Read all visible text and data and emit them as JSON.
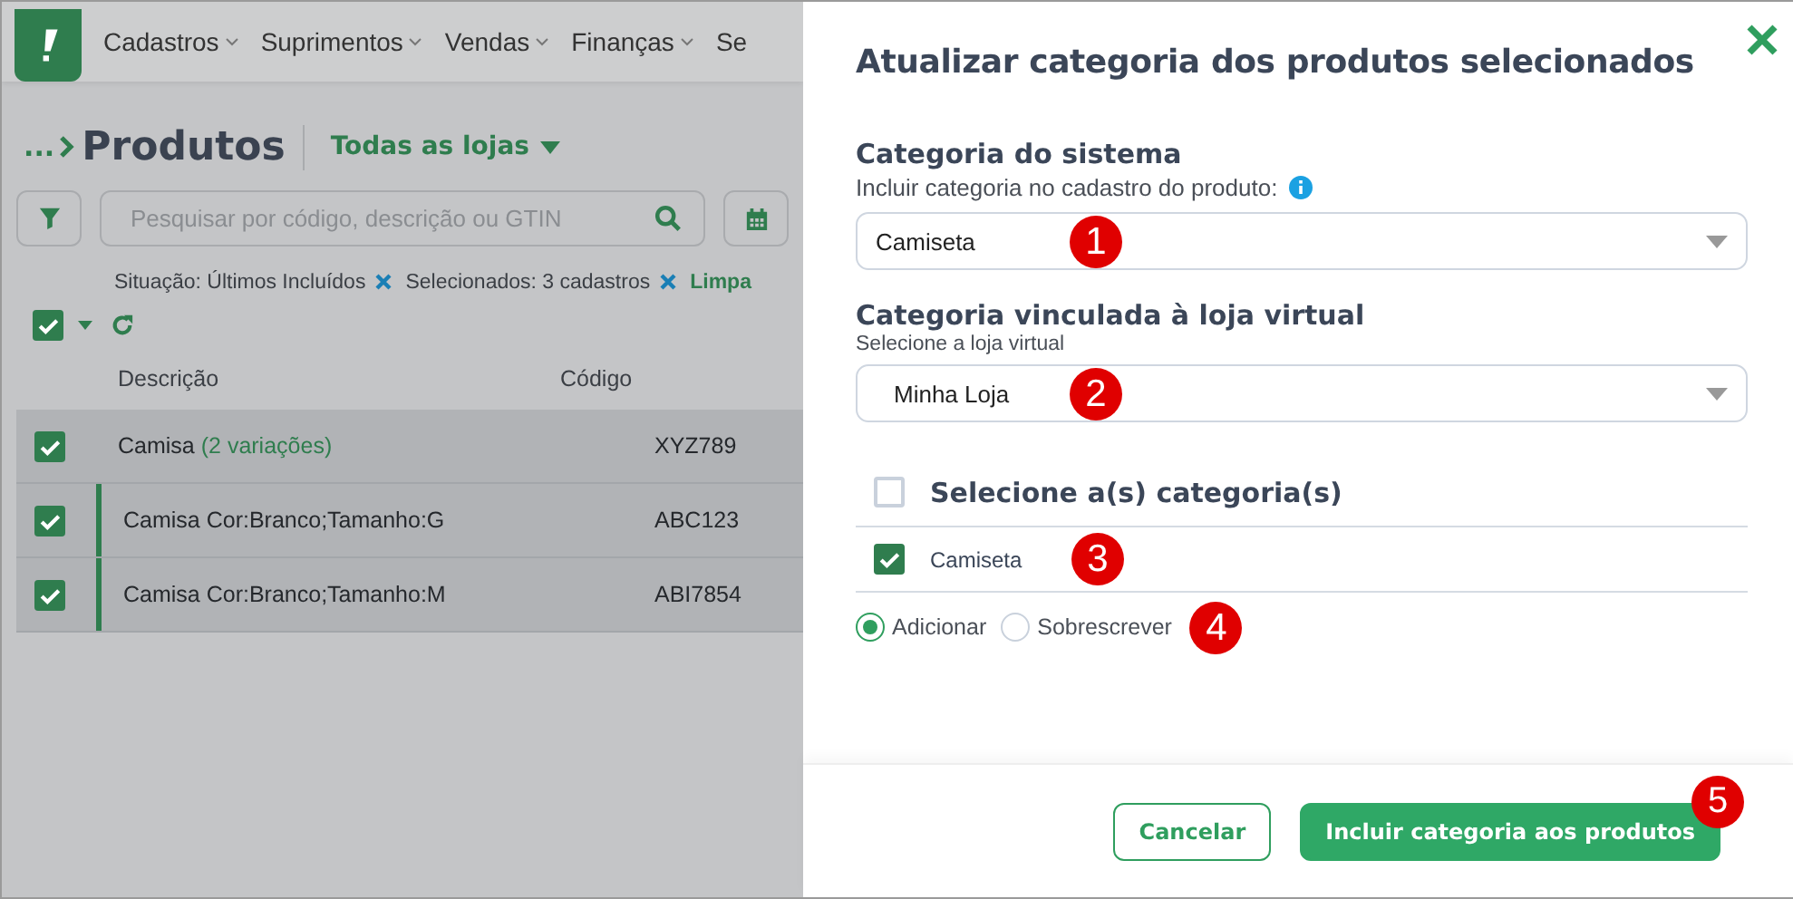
{
  "app": {
    "nav": [
      {
        "label": "Cadastros",
        "dropdown": true
      },
      {
        "label": "Suprimentos",
        "dropdown": true
      },
      {
        "label": "Vendas",
        "dropdown": true
      },
      {
        "label": "Finanças",
        "dropdown": true
      },
      {
        "label": "Se",
        "dropdown": false
      }
    ],
    "breadcrumb": "...",
    "page_title": "Produtos",
    "store_filter": "Todas as lojas",
    "search": {
      "placeholder": "Pesquisar por código, descrição ou GTIN"
    },
    "filters": [
      {
        "label": "Situação: Últimos Incluídos"
      },
      {
        "label": "Selecionados: 3 cadastros"
      }
    ],
    "clear_link": "Limpa",
    "select_all": {
      "checked": true
    },
    "table": {
      "columns": [
        "Descrição",
        "Código"
      ],
      "rows": [
        {
          "description": "Camisa",
          "note": "(2 variações)",
          "code": "XYZ789",
          "checked": true,
          "variation": false
        },
        {
          "description": "Camisa Cor:Branco;Tamanho:G",
          "code": "ABC123",
          "checked": true,
          "variation": true
        },
        {
          "description": "Camisa Cor:Branco;Tamanho:M",
          "code": "ABI7854",
          "checked": true,
          "variation": true
        }
      ]
    }
  },
  "modal": {
    "title": "Atualizar categoria dos produtos selecionados",
    "system_category": {
      "heading": "Categoria do sistema",
      "hint": "Incluir categoria no cadastro do produto:",
      "value": "Camiseta",
      "marker": "1"
    },
    "store_category": {
      "heading": "Categoria vinculada à loja virtual",
      "hint": "Selecione a loja virtual",
      "value": "Minha Loja",
      "marker": "2"
    },
    "category_list": {
      "header": "Selecione a(s) categoria(s)",
      "all_checked": false,
      "items": [
        {
          "label": "Camiseta",
          "checked": true,
          "marker": "3"
        }
      ]
    },
    "modes": [
      {
        "label": "Adicionar",
        "selected": true
      },
      {
        "label": "Sobrescrever",
        "selected": false
      }
    ],
    "modes_marker": "4",
    "buttons": [
      {
        "label": "Cancelar",
        "kind": "secondary"
      },
      {
        "label": "Incluir categoria aos produtos",
        "kind": "primary",
        "marker": "5"
      }
    ]
  }
}
